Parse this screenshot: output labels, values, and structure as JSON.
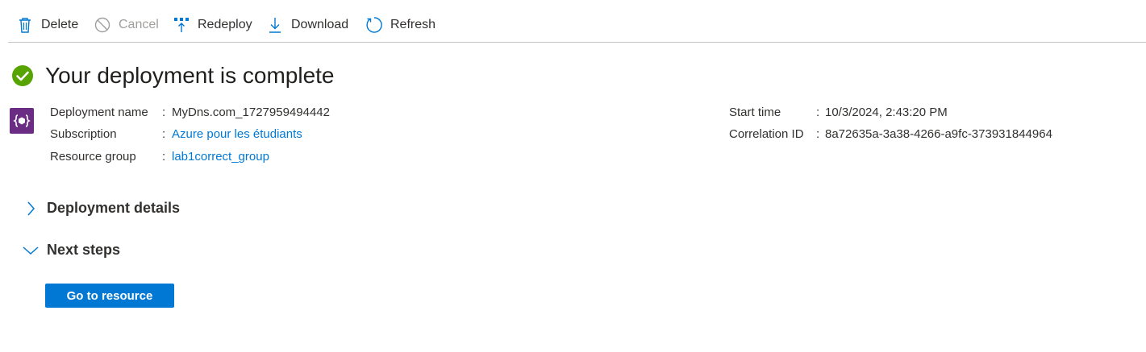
{
  "toolbar": {
    "delete_label": "Delete",
    "cancel_label": "Cancel",
    "redeploy_label": "Redeploy",
    "download_label": "Download",
    "refresh_label": "Refresh"
  },
  "header": {
    "title": "Your deployment is complete",
    "status_icon": "success-check-icon",
    "status_color": "#57a300"
  },
  "details": {
    "deployment_name_label": "Deployment name",
    "deployment_name_value": "MyDns.com_1727959494442",
    "subscription_label": "Subscription",
    "subscription_value": "Azure pour les étudiants",
    "resource_group_label": "Resource group",
    "resource_group_value": "lab1correct_group",
    "start_time_label": "Start time",
    "start_time_value": "10/3/2024, 2:43:20 PM",
    "correlation_id_label": "Correlation ID",
    "correlation_id_value": "8a72635a-3a38-4266-a9fc-373931844964",
    "separator": ":"
  },
  "sections": {
    "deployment_details_label": "Deployment details",
    "next_steps_label": "Next steps"
  },
  "actions": {
    "go_to_resource_label": "Go to resource"
  },
  "colors": {
    "accent": "#0078d4",
    "resource_icon_bg": "#6b2d84",
    "disabled_text": "#a19f9d"
  }
}
